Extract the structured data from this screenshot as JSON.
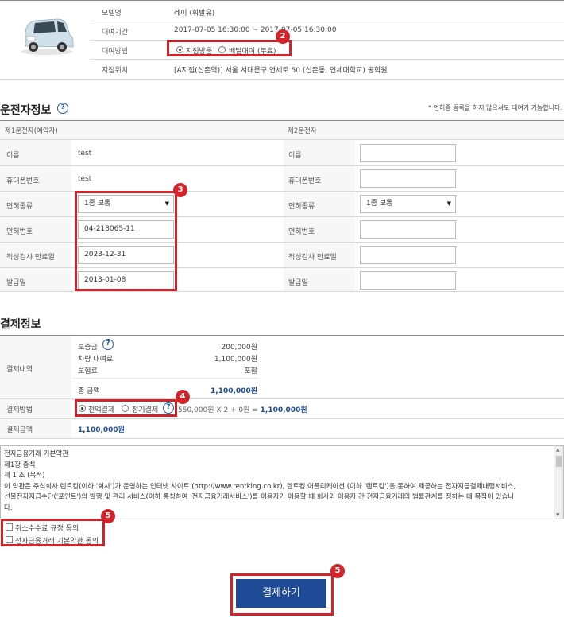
{
  "car": {
    "model_label": "모델명",
    "model_value": "레이 (휘발유)",
    "period_label": "대여기간",
    "period_value": "2017-07-05 16:30:00 ~ 2017-07-05 16:30:00",
    "method_label": "대여방법",
    "method_options": [
      "지점방문",
      "배달대여 (무료)"
    ],
    "location_label": "지점위치",
    "location_value": "[A지점(신촌역)] 서울 서대문구 연세로 50 (신촌동, 연세대학교) 공학원"
  },
  "driver": {
    "title": "운전자정보",
    "notice": "* 면허증 등록을 하지 않으셔도 대여가 가능합니다.",
    "first_header": "제1운전자(예약자)",
    "second_header": "제2운전자",
    "labels": {
      "name": "이름",
      "phone": "휴대폰번호",
      "license_type": "면허종류",
      "license_no": "면허번호",
      "expiry": "적성검사 만료일",
      "issue": "발급일"
    },
    "first": {
      "name": "test",
      "phone": "test",
      "license_type": "1종 보통",
      "license_no": "04-218065-11",
      "expiry": "2023-12-31",
      "issue": "2013-01-08"
    },
    "second": {
      "license_type": "1종 보통"
    }
  },
  "payment": {
    "title": "결제정보",
    "detail_label": "결제내역",
    "deposit_label": "보증금",
    "deposit_value": "200,000원",
    "rental_label": "차량 대여료",
    "rental_value": "1,100,000원",
    "insurance_label": "보험료",
    "insurance_value": "포함",
    "total_label": "총 금액",
    "total_value": "1,100,000원",
    "method_label": "결제방법",
    "method_options": [
      "전액결제",
      "정기결제"
    ],
    "formula": "550,000원 X 2 + 0원 = ",
    "formula_total": "1,100,000원",
    "amount_label": "결제금액",
    "amount_value": "1,100,000원"
  },
  "terms": {
    "lines": [
      "전자금융거래 기본약관",
      "제1장 총칙",
      "제 1 조 (목적)",
      "이 약관은 주식회사 렌트킹(이하 '회사')가 운영하는 인터넷 사이트 (http://www.rentking.co.kr), 렌트킹 어플리케이션 (이하 '렌트킹')을 통하여 제공하는 전자지급결제대행서비스,",
      "선불전자지급수단('포인트')의 발행 및 관리 서비스(이하 통칭하여 '전자금융거래서비스')를 이용자가 이용할 때 회사와 이용자 간 전자금융거래의 법률관계를 정하는 데 목적이 있습니",
      "다."
    ],
    "agree_cancel": "취소수수료 규정 동의",
    "agree_basic": "전자금융거래 기본약관 동의"
  },
  "submit_label": "결제하기",
  "badges": [
    "2",
    "3",
    "4",
    "5",
    "5"
  ],
  "colors": {
    "accent": "#1f4b96",
    "highlight": "#d3232a"
  }
}
